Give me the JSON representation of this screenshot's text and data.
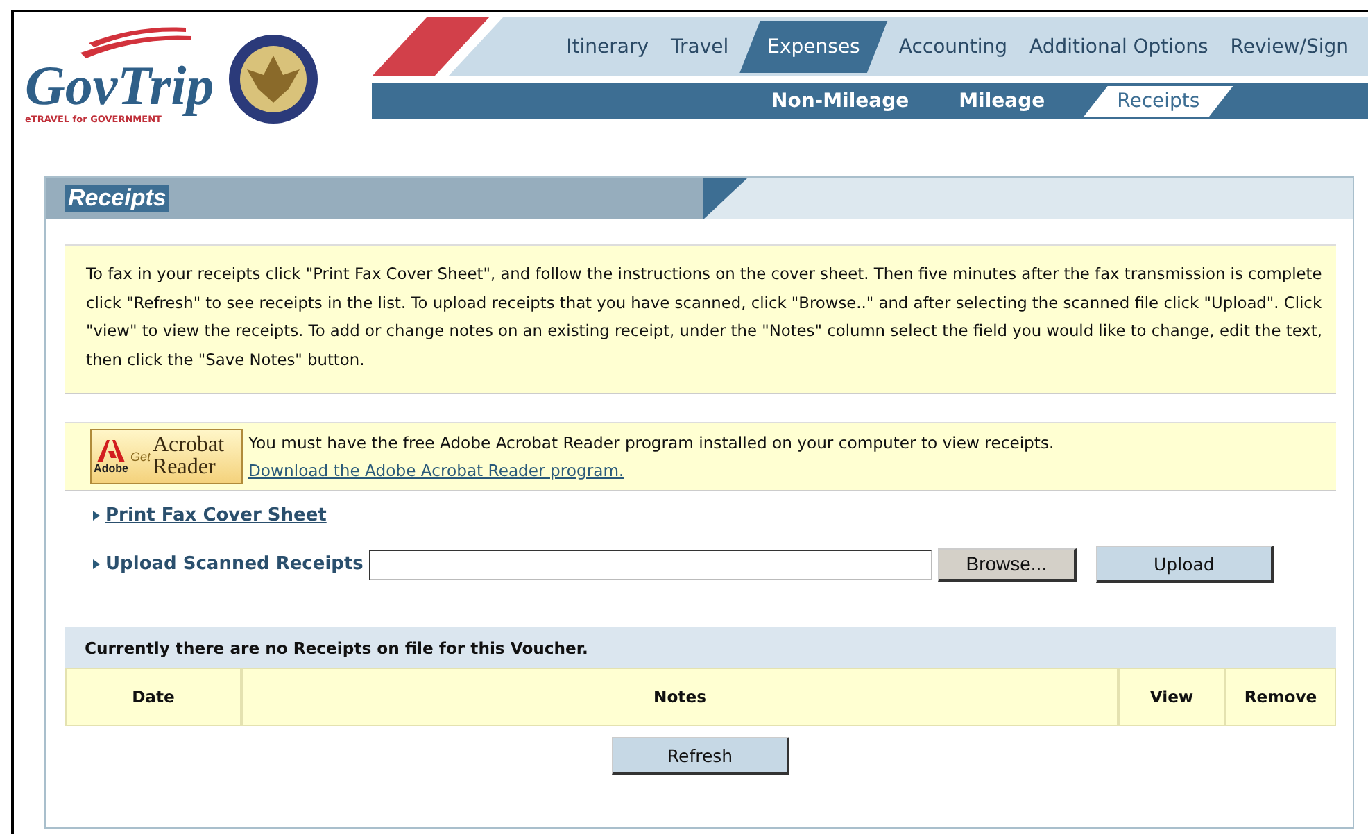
{
  "logo": {
    "name": "GovTrip",
    "tagline": "eTRAVEL for GOVERNMENT"
  },
  "tabs": [
    {
      "label": "Itinerary",
      "selected": false
    },
    {
      "label": "Travel",
      "selected": false
    },
    {
      "label": "Expenses",
      "selected": true
    },
    {
      "label": "Accounting",
      "selected": false
    },
    {
      "label": "Additional Options",
      "selected": false
    },
    {
      "label": "Review/Sign",
      "selected": false
    }
  ],
  "subtabs": [
    {
      "label": "Non-Mileage",
      "selected": false
    },
    {
      "label": "Mileage",
      "selected": false
    },
    {
      "label": "Receipts",
      "selected": true
    }
  ],
  "panel": {
    "title": "Receipts",
    "instructions": "To fax in your receipts click \"Print Fax Cover Sheet\", and follow the instructions on the cover sheet. Then five minutes after the fax transmission is complete click \"Refresh\" to see receipts in the list. To upload receipts that you have scanned, click \"Browse..\" and after selecting the scanned file click \"Upload\". Click \"view\" to view the receipts. To add or change notes on an existing receipt, under the \"Notes\" column select the field you would like to change, edit the text, then click the \"Save Notes\" button.",
    "acrobat_badge": {
      "brand": "Adobe",
      "get": "Get",
      "line1": "Acrobat",
      "line2": "Reader"
    },
    "acrobat_notice": "You must have the free Adobe Acrobat Reader program installed on your computer to view receipts.",
    "acrobat_link": "Download the Adobe Acrobat Reader program.",
    "print_link": "Print Fax Cover Sheet",
    "upload_label": "Upload Scanned Receipts",
    "browse_button": "Browse...",
    "upload_button": "Upload",
    "table": {
      "caption": "Currently there are no Receipts on file for this Voucher.",
      "columns": [
        "Date",
        "Notes",
        "View",
        "Remove"
      ]
    },
    "refresh_button": "Refresh"
  }
}
